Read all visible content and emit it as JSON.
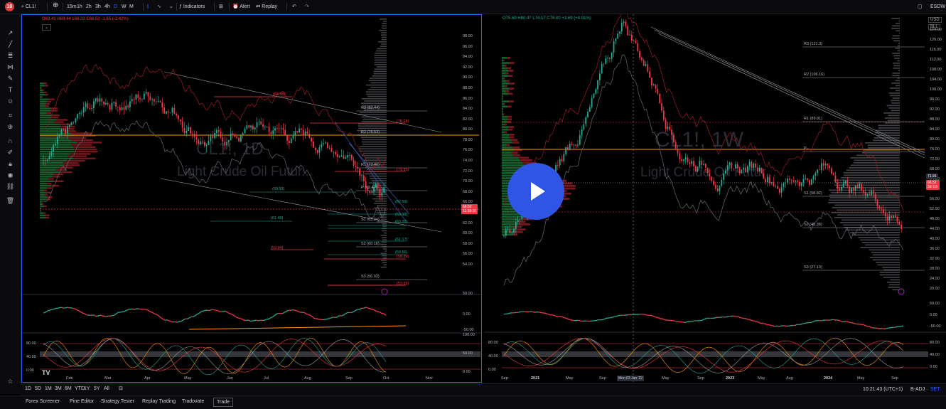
{
  "toolbar": {
    "logo_badge": "10",
    "symbol": "CL1!",
    "intervals": [
      "15m",
      "1h",
      "2h",
      "3h",
      "4h",
      "D",
      "W",
      "M"
    ],
    "active_interval": "D",
    "indicators_label": "Indicators",
    "alert_label": "Alert",
    "replay_label": "Replay",
    "layout_name": "ESDW"
  },
  "left_chart": {
    "ohlc": "O69.41 H69.44 L66.33 C66.52 -1.65 (-2.42%)",
    "collapse": "⌄",
    "watermark_title": "CL1!, 1D",
    "watermark_sub": "Light Crude Oil Futur...",
    "price_ticks": [
      "98.00",
      "96.00",
      "94.00",
      "92.00",
      "90.00",
      "88.00",
      "86.00",
      "84.00",
      "82.00",
      "80.00",
      "78.00",
      "76.00",
      "74.00",
      "72.00",
      "70.00",
      "68.00",
      "66.00",
      "64.00",
      "62.00",
      "60.00",
      "58.00",
      "56.00",
      "54.00",
      "50.00"
    ],
    "last_price": "66.52",
    "countdown": "11:38:16",
    "pivots": [
      "R3 (82.44)",
      "R2 (78.53)",
      "R1 (73.40)",
      "P (69.47)",
      "S1 (63.24)",
      "S2 (60.16)",
      "S3 (56.03)"
    ],
    "red_levels": [
      "(84.38)",
      "(78.28)",
      "(71.85)",
      "(59.94)",
      "(58.89)",
      "(53.99)",
      "(58.78)"
    ],
    "green_levels": [
      "(61.49)",
      "(69.93)",
      "(63.13)",
      "(61.17)",
      "(59.56)",
      "(62.59)",
      "(63.20)"
    ],
    "osc1_ticks": [
      "0.00",
      "-50.00"
    ],
    "osc2_ticks": [
      "100.00",
      "50.00",
      "0.00"
    ],
    "osc2_left_ticks": [
      "80.00",
      "40.00",
      "0.00"
    ],
    "months": [
      "Feb",
      "Mar",
      "Apr",
      "May",
      "Jun",
      "Jul",
      "Aug",
      "Sep",
      "Oct",
      "Nov"
    ]
  },
  "right_chart": {
    "ohlc": "O75.69 H80.47 L74.17 C78.00 +3.69 (+4.91%)",
    "currency": "USD",
    "unit": "BLL",
    "watermark_title": "CL1!, 1W",
    "watermark_sub": "Light Crude Oil Futur...",
    "price_ticks": [
      "124.00",
      "120.00",
      "116.00",
      "112.00",
      "108.00",
      "104.00",
      "100.00",
      "96.00",
      "92.00",
      "88.00",
      "84.00",
      "80.00",
      "76.00",
      "72.00",
      "68.00",
      "64.00",
      "60.00",
      "56.00",
      "52.00",
      "48.00",
      "44.00",
      "40.00",
      "36.00",
      "32.00",
      "28.00",
      "24.00",
      "20.00"
    ],
    "pivots": [
      "R3 (121.3)",
      "R2 (106.16)",
      "R1 (89.91)",
      "P",
      "S1 (58.82)",
      "S2 (45.38)",
      "S3 (27.13)"
    ],
    "last_price": "66.52",
    "countdown": "3d 11h",
    "level_label": "71.91",
    "osc1_ticks": [
      "50.00",
      "0.00",
      "-50.00"
    ],
    "osc2_ticks": [
      "80.00",
      "40.00",
      "0.00"
    ],
    "osc2_left_ticks": [
      "80.00",
      "40.00",
      "0.00"
    ],
    "years": [
      "Sep",
      "2021",
      "May",
      "Sep",
      "2022",
      "May",
      "Sep",
      "2023",
      "May",
      "Aug",
      "2024",
      "May",
      "Sep"
    ],
    "crosshair_date": "Mon 03 Jan '22"
  },
  "bottombar": {
    "ranges": [
      "1D",
      "5D",
      "1M",
      "3M",
      "6M",
      "YTD",
      "1Y",
      "5Y",
      "All"
    ],
    "time": "10:21:43 (UTC+1)",
    "adj": "B-ADJ",
    "session": "SET"
  },
  "footer": {
    "tabs": [
      "Forex Screener",
      "Pine Editor",
      "Strategy Tester",
      "Replay Trading",
      "Tradovate",
      "Trade"
    ]
  },
  "colors": {
    "up": "#22ab94",
    "down": "#f23645",
    "accent": "#2962ff",
    "orange": "#ff9800",
    "play": "#2f55e4"
  }
}
